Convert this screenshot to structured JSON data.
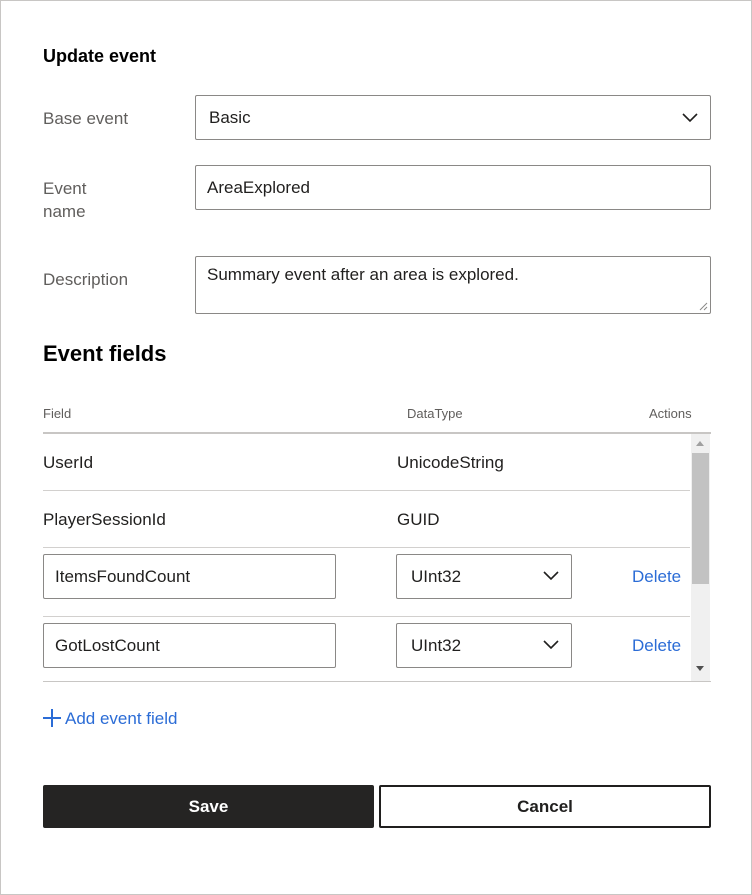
{
  "dialog": {
    "title": "Update event",
    "base_event": {
      "label": "Base event",
      "value": "Basic"
    },
    "event_name": {
      "label": "Event name",
      "value": "AreaExplored"
    },
    "description": {
      "label": "Description",
      "value": "Summary event after an area is explored."
    }
  },
  "fields_section": {
    "title": "Event fields",
    "columns": {
      "field": "Field",
      "datatype": "DataType",
      "actions": "Actions"
    },
    "rows": [
      {
        "field": "UserId",
        "datatype": "UnicodeString",
        "editable": false
      },
      {
        "field": "PlayerSessionId",
        "datatype": "GUID",
        "editable": false
      },
      {
        "field": "ItemsFoundCount",
        "datatype": "UInt32",
        "editable": true,
        "action": "Delete"
      },
      {
        "field": "GotLostCount",
        "datatype": "UInt32",
        "editable": true,
        "action": "Delete"
      }
    ],
    "add_label": "Add event field"
  },
  "buttons": {
    "save": "Save",
    "cancel": "Cancel"
  },
  "colors": {
    "link": "#2b6cd6",
    "primary_button": "#252423",
    "label": "#605e5c"
  },
  "icons": {
    "dropdown": "chevron-down-icon",
    "add": "plus-icon",
    "resize": "resize-grip-icon"
  }
}
